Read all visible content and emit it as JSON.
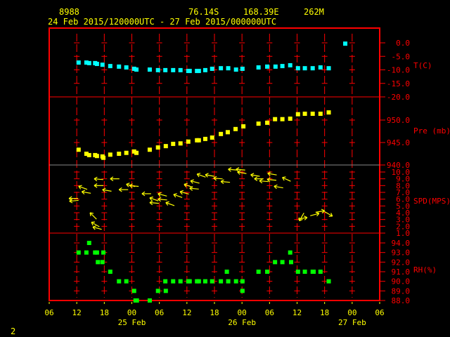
{
  "header": {
    "station_id": "8988",
    "latitude": "76.14S",
    "longitude": "168.39E",
    "elevation": "262M",
    "time_range": "24 Feb 2015/120000UTC - 27 Feb 2015/000000UTC"
  },
  "footer_label": "2",
  "colors": {
    "frame": "#ff0000",
    "text": "#ffff00",
    "temperature": "#00ffff",
    "pressure": "#ffff00",
    "wind": "#ffff00",
    "rh": "#00ff00"
  },
  "chart_data": [
    {
      "type": "scatter",
      "title": "Temperature",
      "ylabel": "T(C)",
      "x_units": "hours since 24 Feb 06UTC",
      "xlim": [
        0,
        72
      ],
      "ylim": [
        -20,
        0
      ],
      "yticks": [
        "0.0",
        "-5.0",
        "-10.0",
        "-15.0",
        "-20.0"
      ],
      "points": [
        [
          6.4,
          -7.3
        ],
        [
          8.1,
          -7.3
        ],
        [
          8.7,
          -7.5
        ],
        [
          10,
          -7.5
        ],
        [
          10.4,
          -7.8
        ],
        [
          11.6,
          -8.1
        ],
        [
          13.3,
          -8.6
        ],
        [
          15.2,
          -8.8
        ],
        [
          16.8,
          -9.1
        ],
        [
          18.5,
          -9.6
        ],
        [
          19,
          -9.9
        ],
        [
          21.9,
          -9.9
        ],
        [
          23.7,
          -10.1
        ],
        [
          25.3,
          -10.1
        ],
        [
          27,
          -10.1
        ],
        [
          28.6,
          -10.1
        ],
        [
          30.3,
          -10.4
        ],
        [
          30.6,
          -10.4
        ],
        [
          32.2,
          -10.4
        ],
        [
          32.6,
          -10.4
        ],
        [
          34,
          -10.1
        ],
        [
          35.5,
          -9.6
        ],
        [
          37.4,
          -9.4
        ],
        [
          39,
          -9.4
        ],
        [
          40.7,
          -9.9
        ],
        [
          42.1,
          -9.6
        ],
        [
          45.6,
          -9.1
        ],
        [
          47.5,
          -8.8
        ],
        [
          49.3,
          -8.8
        ],
        [
          50.8,
          -8.6
        ],
        [
          52.5,
          -8.3
        ],
        [
          54.2,
          -9.4
        ],
        [
          55.7,
          -9.4
        ],
        [
          57.4,
          -9.4
        ],
        [
          59.1,
          -9.1
        ],
        [
          60.9,
          -9.4
        ],
        [
          64.5,
          -0.3
        ]
      ]
    },
    {
      "type": "scatter",
      "title": "Pressure",
      "ylabel": "Pre (mb)",
      "ylim": [
        940,
        955
      ],
      "yticks": [
        "950.0",
        "945.0",
        "940.0"
      ],
      "points": [
        [
          6.4,
          943.4
        ],
        [
          8.1,
          942.5
        ],
        [
          8.7,
          942.2
        ],
        [
          10,
          942.2
        ],
        [
          10.4,
          942
        ],
        [
          11.6,
          941.9
        ],
        [
          11.8,
          941.6
        ],
        [
          13.3,
          942.3
        ],
        [
          15.2,
          942.5
        ],
        [
          16.8,
          942.7
        ],
        [
          18.5,
          943
        ],
        [
          19,
          942.7
        ],
        [
          21.9,
          943.4
        ],
        [
          23.7,
          943.9
        ],
        [
          25.4,
          944.2
        ],
        [
          27,
          944.7
        ],
        [
          28.6,
          944.8
        ],
        [
          30.3,
          945.2
        ],
        [
          32.2,
          945.5
        ],
        [
          32.6,
          945.5
        ],
        [
          34,
          945.8
        ],
        [
          35.5,
          946.1
        ],
        [
          37.4,
          946.9
        ],
        [
          38.9,
          947.3
        ],
        [
          40.6,
          948
        ],
        [
          42.3,
          948.6
        ],
        [
          45.6,
          949.2
        ],
        [
          47.5,
          949.4
        ],
        [
          49.2,
          950.2
        ],
        [
          50.8,
          950.2
        ],
        [
          52.5,
          950.3
        ],
        [
          54.2,
          951.3
        ],
        [
          55.7,
          951.4
        ],
        [
          57.4,
          951.4
        ],
        [
          59.1,
          951.4
        ],
        [
          60.9,
          951.7
        ]
      ]
    },
    {
      "type": "scatter",
      "title": "Wind",
      "ylabel": "SPD(MPS)",
      "ylim": [
        1,
        10
      ],
      "yticks": [
        "10.0",
        "9.0",
        "8.0",
        "7.0",
        "6.0",
        "5.0",
        "4.0",
        "3.0",
        "2.0",
        "1.0"
      ],
      "points_hour_speed_heading": [
        [
          4.3,
          6.1,
          180
        ],
        [
          4.4,
          5.7,
          185
        ],
        [
          6.4,
          7.9,
          160
        ],
        [
          7.1,
          7.1,
          170
        ],
        [
          9.8,
          9.0,
          175
        ],
        [
          9.8,
          8.0,
          180
        ],
        [
          13.3,
          9.0,
          180
        ],
        [
          11.6,
          7.4,
          170
        ],
        [
          15.2,
          7.4,
          180
        ],
        [
          16.8,
          8.2,
          165
        ],
        [
          17.5,
          8.0,
          175
        ],
        [
          20.2,
          6.8,
          180
        ],
        [
          21.9,
          6.2,
          160
        ],
        [
          21.9,
          5.5,
          175
        ],
        [
          23.7,
          6.8,
          165
        ],
        [
          23.7,
          6.0,
          175
        ],
        [
          25.4,
          5.5,
          160
        ],
        [
          27.1,
          6.7,
          160
        ],
        [
          28.5,
          7.1,
          165
        ],
        [
          29.4,
          8.2,
          160
        ],
        [
          30.6,
          7.6,
          175
        ],
        [
          30.8,
          8.7,
          165
        ],
        [
          32.2,
          9.7,
          160
        ],
        [
          34,
          9.6,
          170
        ],
        [
          35.8,
          9.1,
          175
        ],
        [
          37.4,
          8.6,
          175
        ],
        [
          39,
          10.4,
          175
        ],
        [
          40.7,
          10.4,
          175
        ],
        [
          41,
          10,
          170
        ],
        [
          43.9,
          9.6,
          170
        ],
        [
          44.7,
          9.0,
          180
        ],
        [
          45.8,
          8.7,
          175
        ],
        [
          47.5,
          8.9,
          175
        ],
        [
          47.6,
          9.8,
          170
        ],
        [
          49,
          7.9,
          170
        ],
        [
          50.8,
          9.2,
          155
        ],
        [
          54.5,
          2.8,
          240
        ],
        [
          56.2,
          3.3,
          10
        ],
        [
          58.8,
          3.9,
          15
        ],
        [
          60,
          4.3,
          10
        ],
        [
          61.7,
          3.5,
          -30
        ],
        [
          8.9,
          4.0,
          135
        ],
        [
          9.2,
          2.6,
          150
        ],
        [
          9.5,
          1.9,
          165
        ]
      ]
    },
    {
      "type": "scatter",
      "title": "Relative Humidity",
      "ylabel": "RH(%)",
      "ylim": [
        88,
        94
      ],
      "yticks": [
        "94.0",
        "93.0",
        "92.0",
        "91.0",
        "90.0",
        "89.0",
        "88.0"
      ],
      "points": [
        [
          8.7,
          94
        ],
        [
          6.4,
          93
        ],
        [
          8.1,
          93
        ],
        [
          10,
          93
        ],
        [
          10.4,
          93
        ],
        [
          11.8,
          93
        ],
        [
          52.5,
          93
        ],
        [
          10.6,
          92
        ],
        [
          11.6,
          92
        ],
        [
          49.2,
          92
        ],
        [
          50.8,
          92
        ],
        [
          52.7,
          92
        ],
        [
          13.3,
          91
        ],
        [
          38.7,
          91
        ],
        [
          45.6,
          91
        ],
        [
          47.5,
          91
        ],
        [
          54.2,
          91
        ],
        [
          55.7,
          91
        ],
        [
          57.4,
          91
        ],
        [
          57.6,
          91
        ],
        [
          59.1,
          91
        ],
        [
          15.2,
          90
        ],
        [
          16.8,
          90
        ],
        [
          25.3,
          90
        ],
        [
          27,
          90
        ],
        [
          28.6,
          90
        ],
        [
          30.3,
          90
        ],
        [
          30.6,
          90
        ],
        [
          32.2,
          90
        ],
        [
          32.6,
          90
        ],
        [
          34,
          90
        ],
        [
          35.5,
          90
        ],
        [
          37.4,
          90
        ],
        [
          39,
          90
        ],
        [
          40.7,
          90
        ],
        [
          42.1,
          90
        ],
        [
          60.9,
          90
        ],
        [
          18.5,
          89
        ],
        [
          23.7,
          89
        ],
        [
          25.4,
          89
        ],
        [
          42.1,
          89
        ],
        [
          18.8,
          88
        ],
        [
          19.1,
          88
        ],
        [
          21.9,
          88
        ]
      ]
    }
  ],
  "x_axis": {
    "tick_labels": [
      "06",
      "12",
      "18",
      "00",
      "06",
      "12",
      "18",
      "00",
      "06",
      "12",
      "18",
      "00",
      "06"
    ],
    "date_labels": [
      {
        "label": "25 Feb",
        "hour": 18
      },
      {
        "label": "26 Feb",
        "hour": 42
      },
      {
        "label": "27 Feb",
        "hour": 66
      }
    ]
  }
}
